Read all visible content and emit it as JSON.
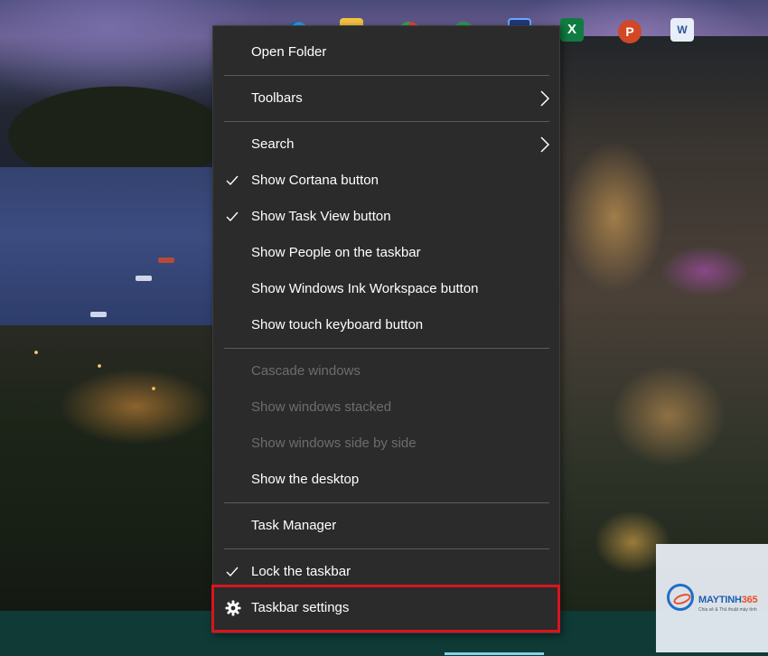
{
  "menu": {
    "items": [
      {
        "label": "Open Folder"
      },
      {
        "label": "Toolbars",
        "submenu": true
      },
      {
        "label": "Search",
        "submenu": true
      },
      {
        "label": "Show Cortana button",
        "checked": true
      },
      {
        "label": "Show Task View button",
        "checked": true
      },
      {
        "label": "Show People on the taskbar"
      },
      {
        "label": "Show Windows Ink Workspace button"
      },
      {
        "label": "Show touch keyboard button"
      },
      {
        "label": "Cascade windows",
        "disabled": true
      },
      {
        "label": "Show windows stacked",
        "disabled": true
      },
      {
        "label": "Show windows side by side",
        "disabled": true
      },
      {
        "label": "Show the desktop"
      },
      {
        "label": "Task Manager"
      },
      {
        "label": "Lock the taskbar",
        "checked": true
      },
      {
        "label": "Taskbar settings",
        "icon": "gear-icon",
        "highlighted": true
      }
    ]
  },
  "taskbar": {
    "icons": [
      "edge-icon",
      "file-explorer-icon",
      "chrome-icon",
      "chrome-profile-icon",
      "app-icon",
      "excel-icon",
      "powerpoint-icon",
      "word-icon"
    ],
    "excel_glyph": "X",
    "ppt_glyph": "P",
    "word_glyph": "W"
  },
  "watermark": {
    "brand_main": "MAYTINH",
    "brand_accent": "365",
    "tagline": "Chia sẻ & Thủ thuật máy tính"
  },
  "colors": {
    "menu_bg": "#2b2b2b",
    "menu_text": "#ffffff",
    "menu_disabled_text": "#6d6d6d",
    "separator": "#5b5b5b",
    "highlight": "#d7151f",
    "taskbar_bg": "#0f3a36"
  }
}
